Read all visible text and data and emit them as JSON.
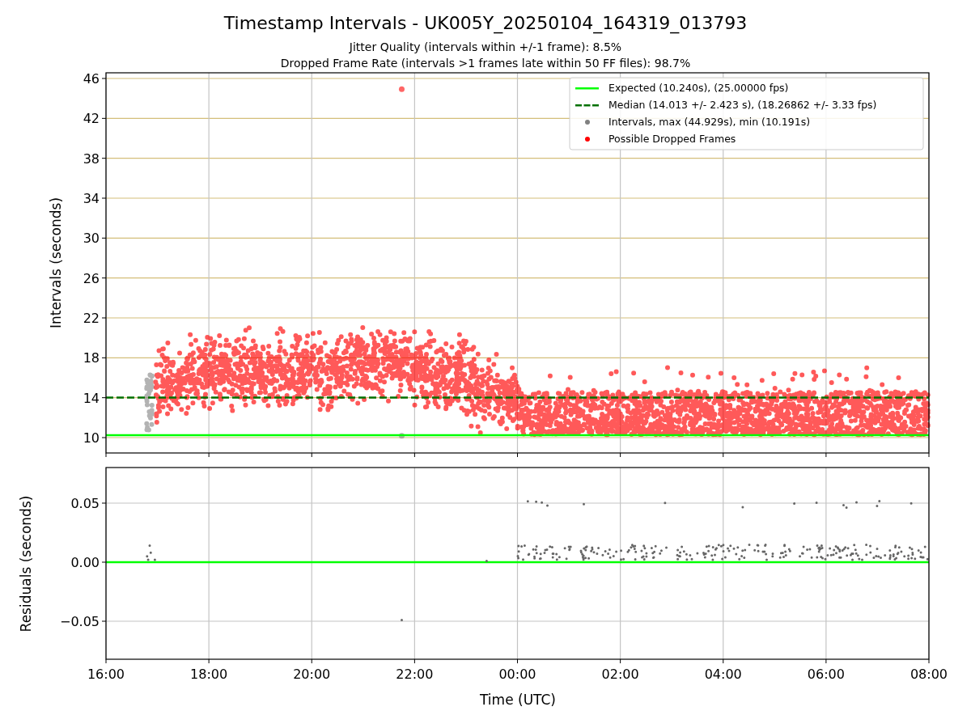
{
  "title": "Timestamp Intervals - UK005Y_20250104_164319_013793",
  "subtitles": [
    "Jitter Quality (intervals within +/-1 frame): 8.5%",
    "Dropped Frame Rate (intervals >1 frames late within 50 FF files): 98.7%"
  ],
  "top_plot": {
    "ylabel": "Intervals (seconds)",
    "yticks": [
      "46",
      "42",
      "38",
      "34",
      "30",
      "26",
      "22",
      "18",
      "14",
      "10"
    ],
    "legend": [
      {
        "label": "Expected (10.240s), (25.00000 fps)",
        "kind": "line",
        "color": "#00ff00"
      },
      {
        "label": "Median (14.013 +/- 2.423 s), (18.26862 +/- 3.33 fps)",
        "kind": "dashed",
        "color": "#007000"
      },
      {
        "label": "Intervals, max (44.929s), min (10.191s)",
        "kind": "dot",
        "color": "#808080"
      },
      {
        "label": "Possible Dropped Frames",
        "kind": "dot",
        "color": "#ff0000"
      }
    ]
  },
  "bottom_plot": {
    "ylabel": "Residuals (seconds)",
    "yticks": [
      "0.05",
      "0.00",
      "−0.05"
    ]
  },
  "x_axis": {
    "label": "Time (UTC)",
    "ticks": [
      "16:00",
      "18:00",
      "20:00",
      "22:00",
      "00:00",
      "02:00",
      "04:00",
      "06:00",
      "08:00"
    ]
  }
}
